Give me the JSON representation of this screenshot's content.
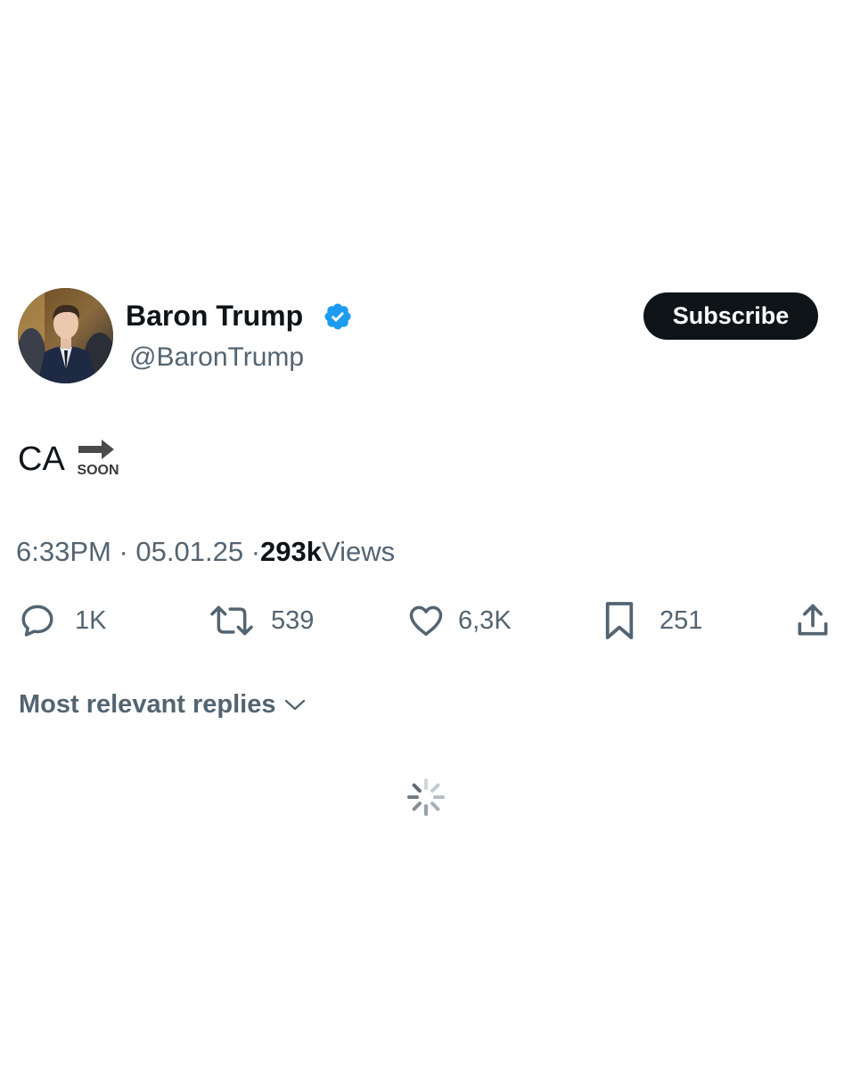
{
  "author": {
    "display_name": "Baron Trump",
    "handle": "@BaronTrump",
    "verified": true,
    "verified_color": "#1d9bf0",
    "avatar_icon": "profile-photo"
  },
  "subscribe_label": "Subscribe",
  "tweet": {
    "text": "CA",
    "emoji": "soon-arrow-emoji",
    "emoji_text": "SOON"
  },
  "meta": {
    "time": "6:33PM",
    "separator": "·",
    "date": "05.01.25",
    "views_count": "293k",
    "views_label": "Views"
  },
  "actions": {
    "replies": "1K",
    "retweets": "539",
    "likes": "6,3K",
    "bookmarks": "251"
  },
  "replies_sort": {
    "label": "Most relevant replies"
  },
  "colors": {
    "primary_text": "#0f1419",
    "secondary_text": "#536471",
    "button_bg": "#0f1419"
  }
}
